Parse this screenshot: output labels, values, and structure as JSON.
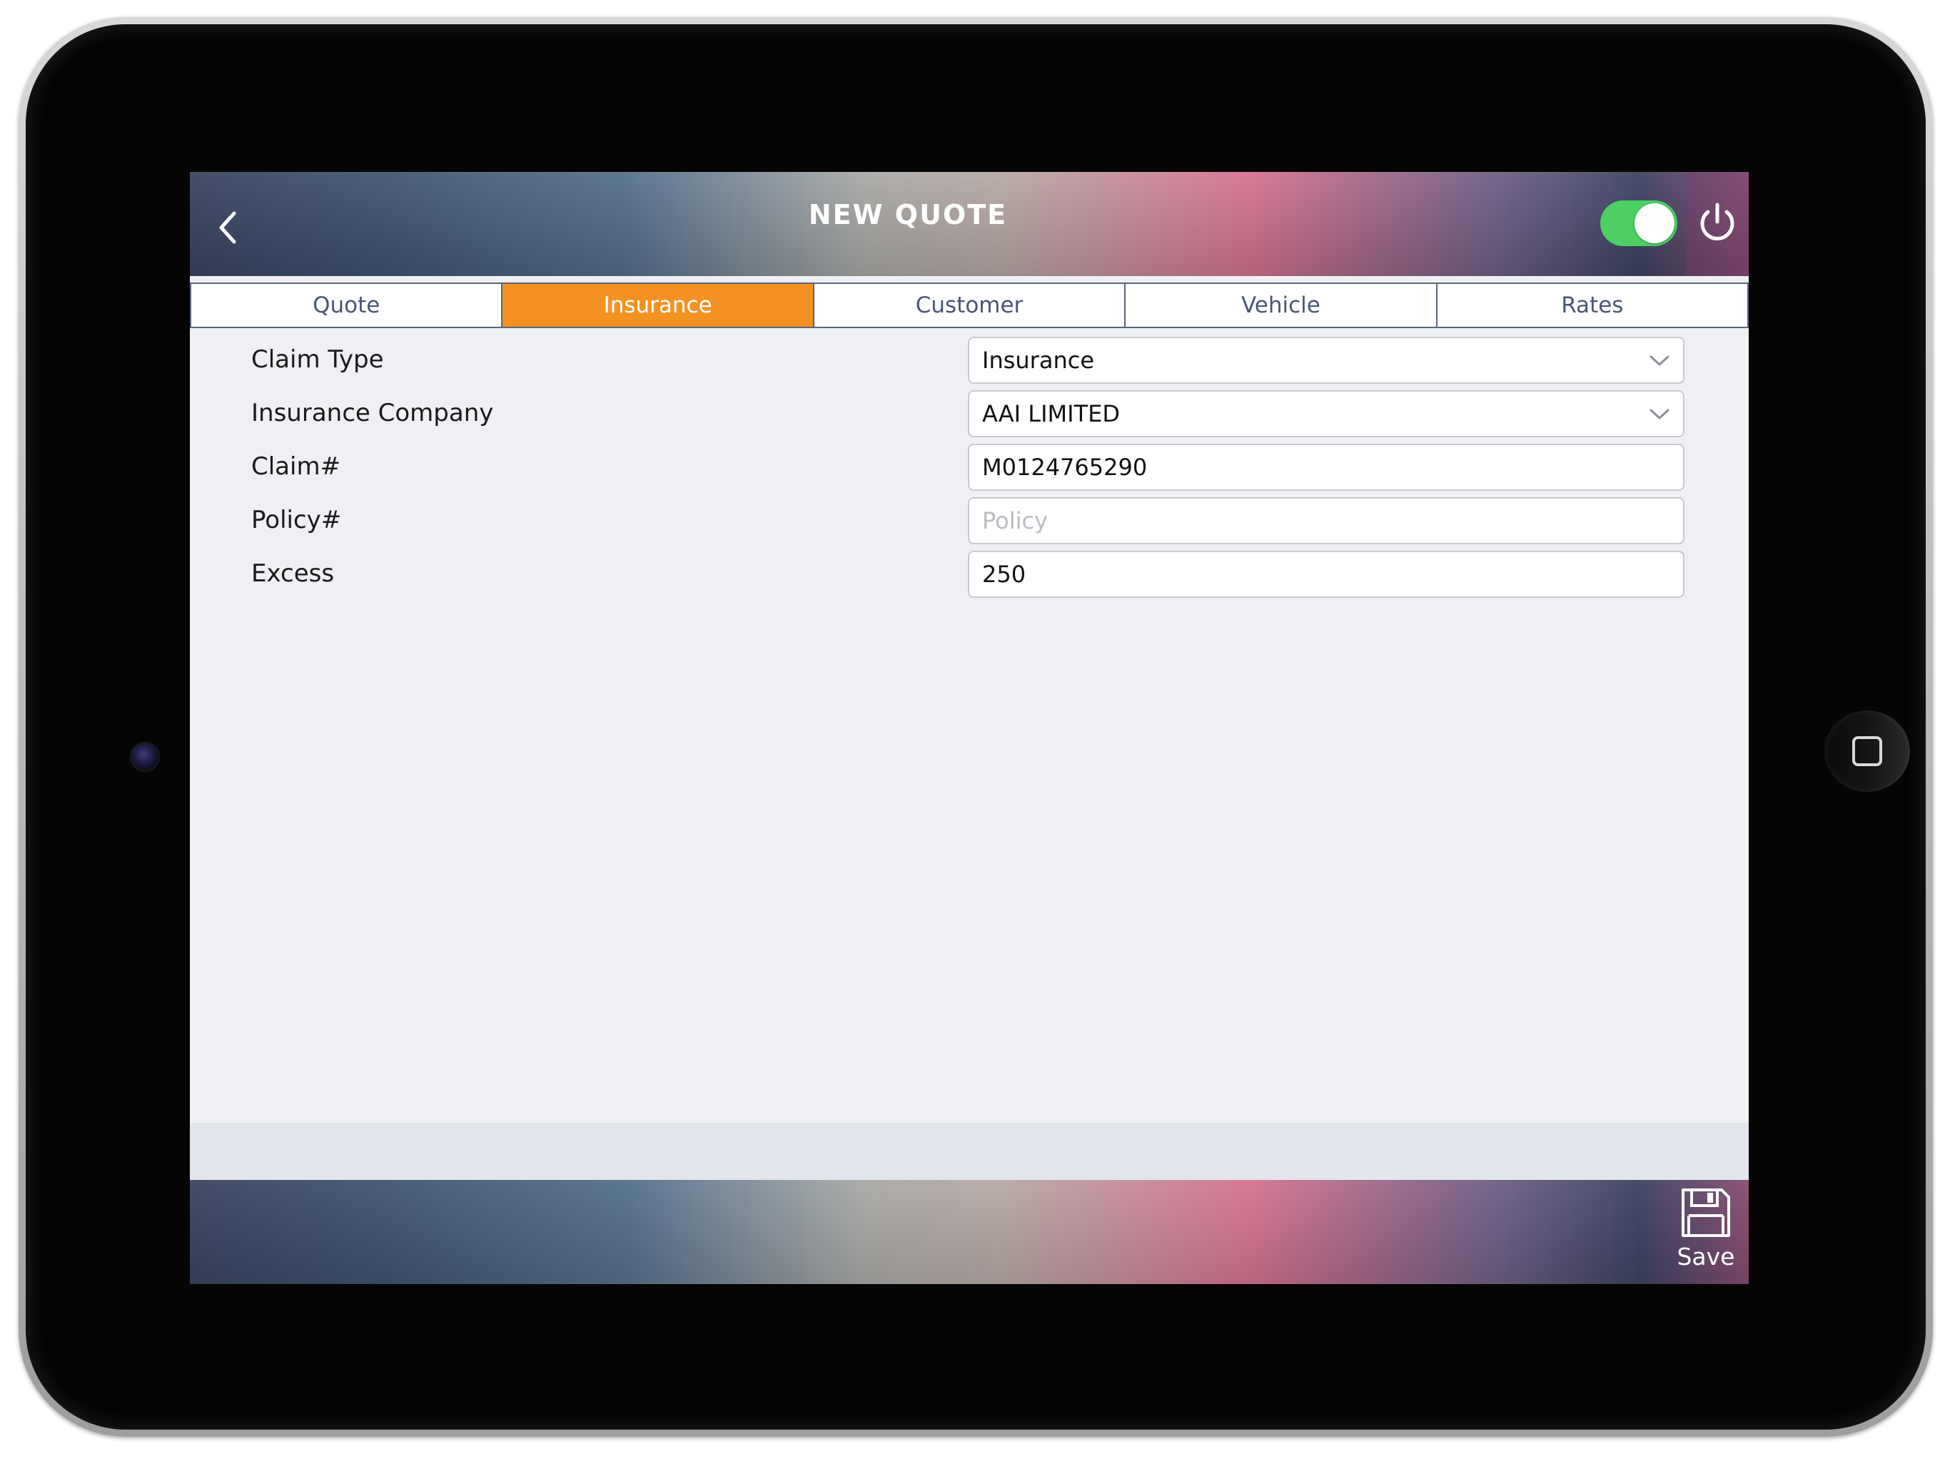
{
  "header": {
    "title": "NEW QUOTE",
    "toggle_on": true,
    "toggle_color": "#4ccf63"
  },
  "tabs": [
    {
      "label": "Quote",
      "active": false
    },
    {
      "label": "Insurance",
      "active": true
    },
    {
      "label": "Customer",
      "active": false
    },
    {
      "label": "Vehicle",
      "active": false
    },
    {
      "label": "Rates",
      "active": false
    }
  ],
  "accent_color": "#f39223",
  "form": {
    "claim_type": {
      "label": "Claim Type",
      "value": "Insurance"
    },
    "insurance_company": {
      "label": "Insurance Company",
      "value": "AAI LIMITED"
    },
    "claim_number": {
      "label": "Claim#",
      "value": "M0124765290"
    },
    "policy_number": {
      "label": "Policy#",
      "value": "",
      "placeholder": "Policy"
    },
    "excess": {
      "label": "Excess",
      "value": "250"
    }
  },
  "footer": {
    "save_label": "Save"
  },
  "icons": {
    "back": "chevron-left-icon",
    "power": "power-icon",
    "save": "floppy-disk-icon",
    "dropdown": "chevron-down-icon",
    "home": "home-button-square"
  }
}
